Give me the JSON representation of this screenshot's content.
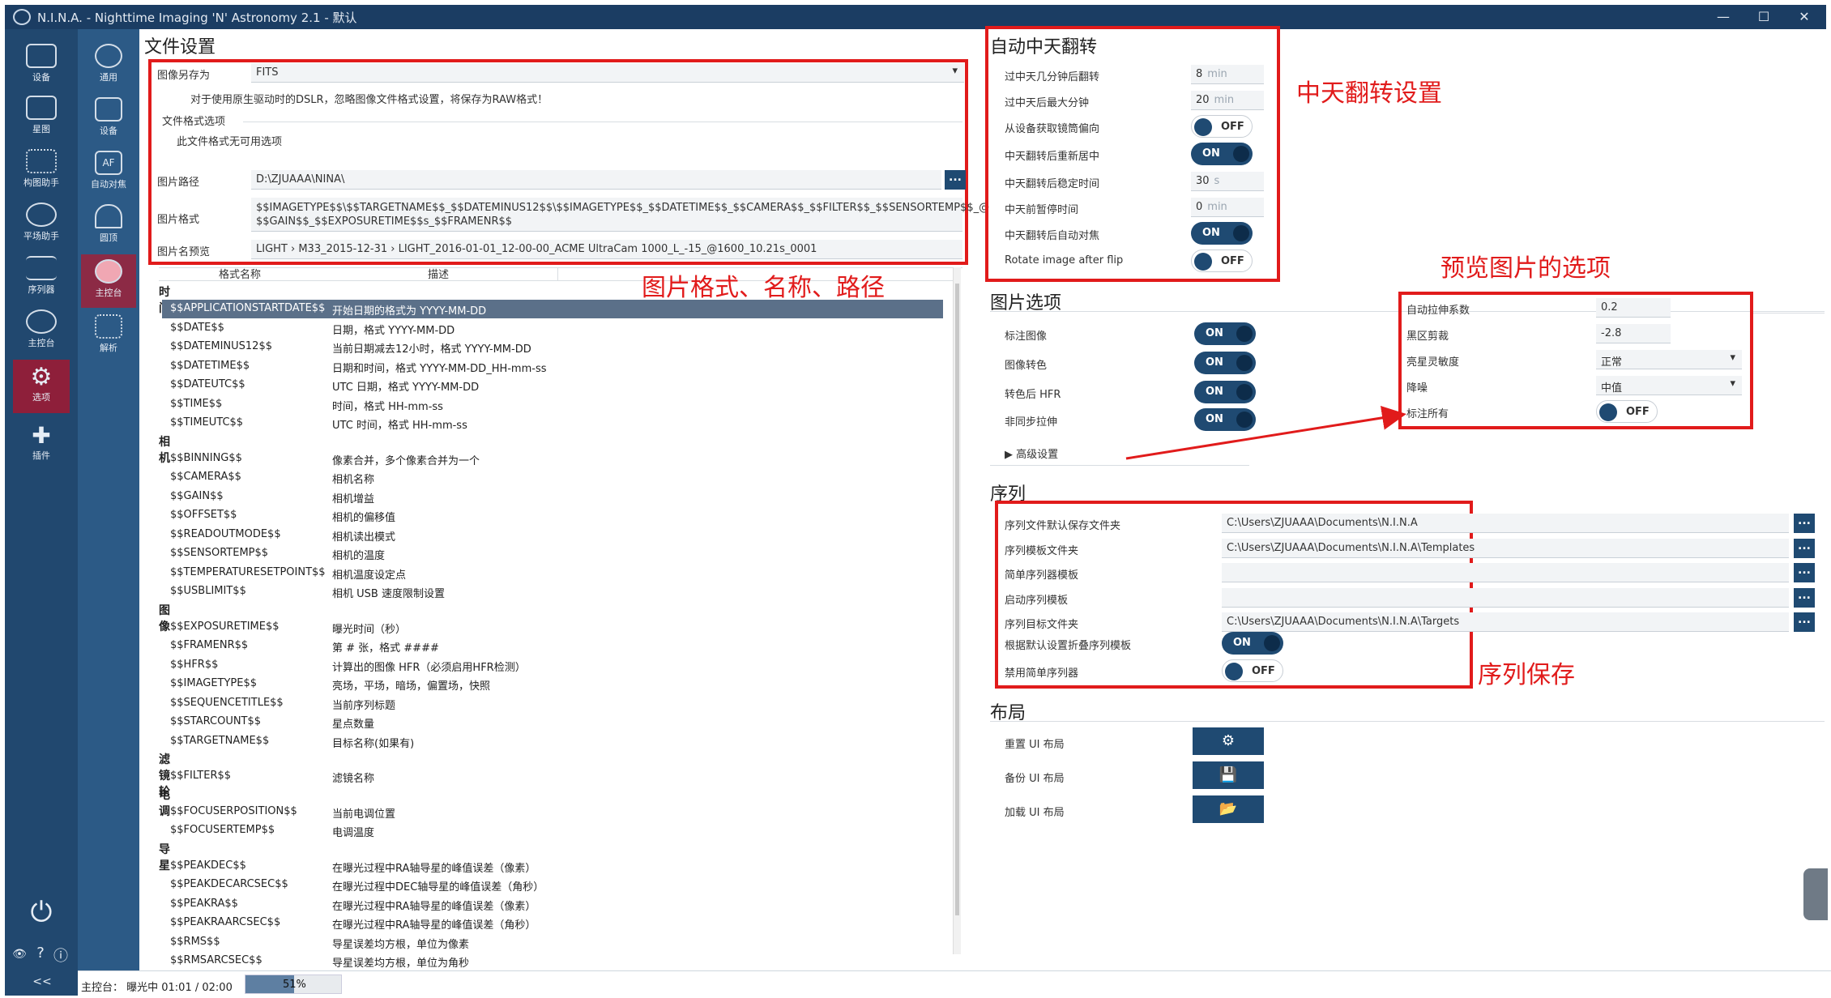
{
  "window": {
    "title": "N.I.N.A. - Nighttime Imaging 'N' Astronomy 2.1 - 默认",
    "min": "—",
    "max": "☐",
    "close": "✕"
  },
  "sidebar": {
    "items": [
      {
        "label": "设备"
      },
      {
        "label": "星图"
      },
      {
        "label": "构图助手"
      },
      {
        "label": "平场助手"
      },
      {
        "label": "序列器"
      },
      {
        "label": "主控台"
      },
      {
        "label": "选项"
      },
      {
        "label": "插件"
      }
    ],
    "power": "⏻",
    "bottom": {
      "eye": "👁",
      "help": "?",
      "info": "ⓘ",
      "collapse": "<<"
    }
  },
  "subnav": {
    "items": [
      {
        "label": "通用"
      },
      {
        "label": "设备"
      },
      {
        "label": "自动对焦"
      },
      {
        "label": "圆顶"
      },
      {
        "label": "主控台"
      },
      {
        "label": "解析"
      }
    ]
  },
  "file_settings": {
    "header": "文件设置",
    "save_as_label": "图像另存为",
    "save_as_value": "FITS",
    "note": "对于使用原生驱动时的DSLR，忽略图像文件格式设置，将保存为RAW格式！",
    "options_label": "文件格式选项",
    "options_note": "此文件格式无可用选项",
    "path_label": "图片路径",
    "path_value": "D:\\ZJUAAA\\NINA\\",
    "pattern_label": "图片格式",
    "pattern_value_1": "$$IMAGETYPE$$\\$$TARGETNAME$$_$$DATEMINUS12$$\\$$IMAGETYPE$$_$$DATETIME$$_$$CAMERA$$_$$FILTER$$_$$SENSORTEMP$$_@",
    "pattern_value_2": "$$GAIN$$_$$EXPOSURETIME$$s_$$FRAMENR$$",
    "preview_label": "图片名预览",
    "preview_value": "LIGHT › M33_2015-12-31 › LIGHT_2016-01-01_12-00-00_ACME UltraCam 1000_L_-15_@1600_10.21s_0001",
    "col_name": "格式名称",
    "col_desc": "描述"
  },
  "tokens": [
    {
      "type": "cat",
      "text": "时间"
    },
    {
      "n": "$$APPLICATIONSTARTDATE$$",
      "d": "开始日期的格式为 YYYY-MM-DD",
      "sel": true
    },
    {
      "n": "$$DATE$$",
      "d": "日期，格式 YYYY-MM-DD"
    },
    {
      "n": "$$DATEMINUS12$$",
      "d": "当前日期减去12小时，格式 YYYY-MM-DD"
    },
    {
      "n": "$$DATETIME$$",
      "d": "日期和时间，格式 YYYY-MM-DD_HH-mm-ss"
    },
    {
      "n": "$$DATEUTC$$",
      "d": "UTC 日期，格式 YYYY-MM-DD"
    },
    {
      "n": "$$TIME$$",
      "d": "时间，格式 HH-mm-ss"
    },
    {
      "n": "$$TIMEUTC$$",
      "d": "UTC 时间，格式 HH-mm-ss"
    },
    {
      "type": "cat",
      "text": "相机"
    },
    {
      "n": "$$BINNING$$",
      "d": "像素合并，多个像素合并为一个"
    },
    {
      "n": "$$CAMERA$$",
      "d": "相机名称"
    },
    {
      "n": "$$GAIN$$",
      "d": "相机增益"
    },
    {
      "n": "$$OFFSET$$",
      "d": "相机的偏移值"
    },
    {
      "n": "$$READOUTMODE$$",
      "d": "相机读出模式"
    },
    {
      "n": "$$SENSORTEMP$$",
      "d": "相机的温度"
    },
    {
      "n": "$$TEMPERATURESETPOINT$$",
      "d": "相机温度设定点"
    },
    {
      "n": "$$USBLIMIT$$",
      "d": "相机 USB 速度限制设置"
    },
    {
      "type": "cat",
      "text": "图像"
    },
    {
      "n": "$$EXPOSURETIME$$",
      "d": "曝光时间（秒）"
    },
    {
      "n": "$$FRAMENR$$",
      "d": "第 # 张，格式 ####"
    },
    {
      "n": "$$HFR$$",
      "d": "计算出的图像 HFR（必须启用HFR检测）"
    },
    {
      "n": "$$IMAGETYPE$$",
      "d": "亮场，平场，暗场，偏置场，快照"
    },
    {
      "n": "$$SEQUENCETITLE$$",
      "d": "当前序列标题"
    },
    {
      "n": "$$STARCOUNT$$",
      "d": "星点数量"
    },
    {
      "n": "$$TARGETNAME$$",
      "d": "目标名称(如果有)"
    },
    {
      "type": "cat",
      "text": "滤镜轮"
    },
    {
      "n": "$$FILTER$$",
      "d": "滤镜名称"
    },
    {
      "type": "cat",
      "text": "电调"
    },
    {
      "n": "$$FOCUSERPOSITION$$",
      "d": "当前电调位置"
    },
    {
      "n": "$$FOCUSERTEMP$$",
      "d": "电调温度"
    },
    {
      "type": "cat",
      "text": "导星"
    },
    {
      "n": "$$PEAKDEC$$",
      "d": "在曝光过程中RA轴导星的峰值误差（像素）"
    },
    {
      "n": "$$PEAKDECARCSEC$$",
      "d": "在曝光过程中DEC轴导星的峰值误差（角秒）"
    },
    {
      "n": "$$PEAKRA$$",
      "d": "在曝光过程中RA轴导星的峰值误差（像素）"
    },
    {
      "n": "$$PEAKRAARCSEC$$",
      "d": "在曝光过程中RA轴导星的峰值误差（角秒）"
    },
    {
      "n": "$$RMS$$",
      "d": "导星误差均方根，单位为像素"
    },
    {
      "n": "$$RMSARCSEC$$",
      "d": "导星误差均方根，单位为角秒"
    }
  ],
  "flip": {
    "header": "自动中天翻转",
    "rows": {
      "minutes_after": {
        "label": "过中天几分钟后翻转",
        "value": "8",
        "unit": "min"
      },
      "max_minutes": {
        "label": "过中天后最大分钟",
        "value": "20",
        "unit": "min"
      },
      "use_offsets": {
        "label": "从设备获取镜筒偏向",
        "state": "OFF"
      },
      "recenter": {
        "label": "中天翻转后重新居中",
        "state": "ON"
      },
      "settle": {
        "label": "中天翻转后稳定时间",
        "value": "30",
        "unit": "s"
      },
      "pause": {
        "label": "中天前暂停时间",
        "value": "0",
        "unit": "min"
      },
      "autofocus": {
        "label": "中天翻转后自动对焦",
        "state": "ON"
      },
      "rotate": {
        "label": "Rotate image after flip",
        "state": "OFF"
      }
    }
  },
  "image_options": {
    "header": "图片选项",
    "rows": [
      {
        "label": "标注图像",
        "state": "ON"
      },
      {
        "label": "图像转色",
        "state": "ON"
      },
      {
        "label": "转色后 HFR",
        "state": "ON"
      },
      {
        "label": "非同步拉伸",
        "state": "ON"
      }
    ],
    "advanced": "高级设置",
    "stretch_factor": {
      "label": "自动拉伸系数",
      "value": "0.2"
    },
    "black_clip": {
      "label": "黑区剪裁",
      "value": "-2.8"
    },
    "star_sensitivity": {
      "label": "亮星灵敏度",
      "value": "正常"
    },
    "noise": {
      "label": "降噪",
      "value": "中值"
    },
    "annotate_all": {
      "label": "标注所有",
      "state": "OFF"
    }
  },
  "sequence": {
    "header": "序列",
    "rows": [
      {
        "label": "序列文件默认保存文件夹",
        "value": "C:\\Users\\ZJUAAA\\Documents\\N.I.N.A"
      },
      {
        "label": "序列模板文件夹",
        "value": "C:\\Users\\ZJUAAA\\Documents\\N.I.N.A\\Templates"
      },
      {
        "label": "简单序列器模板",
        "value": ""
      },
      {
        "label": "启动序列模板",
        "value": ""
      },
      {
        "label": "序列目标文件夹",
        "value": "C:\\Users\\ZJUAAA\\Documents\\N.I.N.A\\Targets"
      }
    ],
    "collapse": {
      "label": "根据默认设置折叠序列模板",
      "state": "ON"
    },
    "disable_simple": {
      "label": "禁用简单序列器",
      "state": "OFF"
    }
  },
  "layout": {
    "header": "布局",
    "reset": "重置 UI 布局",
    "backup": "备份 UI 布局",
    "load": "加载 UI 布局"
  },
  "annotations": {
    "flip": "中天翻转设置",
    "preview": "预览图片的选项",
    "format": "图片格式、名称、路径",
    "sequence": "序列保存"
  },
  "statusbar": {
    "text": "主控台： 曝光中 01:01 / 02:00",
    "progress_pct": 51,
    "progress_label": "51%"
  },
  "colors": {
    "accent": "#1f4a72",
    "annotation": "#e11b1b",
    "sidebar": "#21486f"
  },
  "icons": {
    "dots": "...",
    "gear": "⚙",
    "save": "💾",
    "load": "📂",
    "expand": "▶",
    "dropdown": "▾"
  }
}
